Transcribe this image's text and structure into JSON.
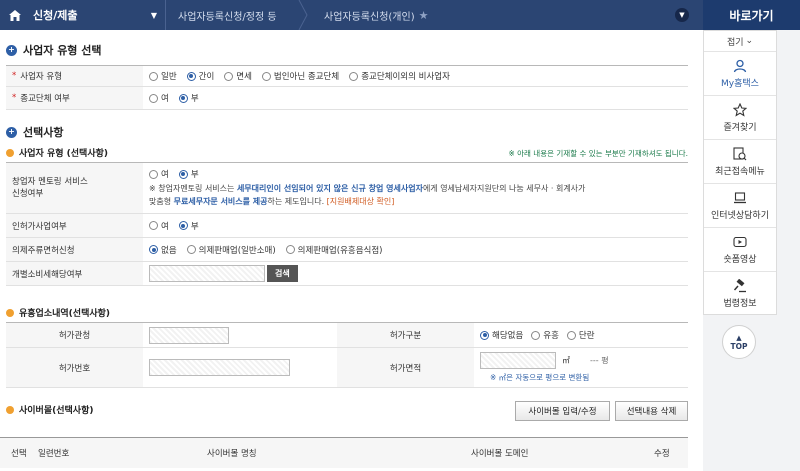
{
  "topbar": {
    "menu": "신청/제출",
    "crumb2": "사업자등록신청/정정 등",
    "crumb3": "사업자등록신청(개인)"
  },
  "section1": {
    "title": "사업자 유형 선택",
    "rows": [
      {
        "label": "사업자 유형",
        "options": [
          "일반",
          "간이",
          "면세",
          "법인아닌 종교단체",
          "종교단체이외의 비사업자"
        ],
        "selected": "간이"
      },
      {
        "label": "종교단체 여부",
        "options": [
          "여",
          "부"
        ],
        "selected": "부"
      }
    ]
  },
  "section2": {
    "title": "선택사항",
    "sub_title": "사업자 유형 (선택사항)",
    "note": "※ 아래 내용은 기재할 수 있는 부분만 기재하셔도 됩니다.",
    "mentoring": {
      "label_line1": "창업자 멘토링 서비스",
      "label_line2": "신청여부",
      "options": [
        "여",
        "부"
      ],
      "selected": "부",
      "desc_1": "※ 창업자멘토링 서비스는 ",
      "desc_hl1": "세무대리인이 선임되어 있지 않은 신규 창업 영세사업자",
      "desc_2": "에게 영세납세자지원단의 나눔 세무사 · 회계사가",
      "desc_3": "맞춤형 ",
      "desc_hl2": "무료세무자문 서비스를 제공",
      "desc_4": "하는 제도입니다. ",
      "desc_link": "[지원배제대상 확인]"
    },
    "permit_biz": {
      "label": "인허가사업여부",
      "options": [
        "여",
        "부"
      ],
      "selected": "부"
    },
    "liquor": {
      "label": "의제주류면허신청",
      "options": [
        "없음",
        "의제판매업(일반소매)",
        "의제판매업(유흥음식점)"
      ],
      "selected": "없음"
    },
    "excise": {
      "label": "개별소비세해당여부",
      "button": "검색"
    }
  },
  "entertainment": {
    "title": "유흥업소내역(선택사항)",
    "labels": {
      "office": "허가관청",
      "category": "허가구분",
      "number": "허가번호",
      "area": "허가면적"
    },
    "category_options": [
      "해당없음",
      "유흥",
      "단란"
    ],
    "category_selected": "해당없음",
    "area_unit": "㎡",
    "area_pyeong": "--- 평",
    "area_note": "※ ㎡은 자동으로 평으로 변환됨"
  },
  "cybermall": {
    "title": "사이버몰(선택사항)",
    "btn_input": "사이버몰 입력/수정",
    "btn_delete": "선택내용 삭제",
    "columns": [
      "선택",
      "일련번호",
      "사이버몰 명칭",
      "사이버몰 도메인",
      "수정"
    ]
  },
  "sidebar": {
    "title": "바로가기",
    "fold": "접기",
    "items": [
      {
        "label": "My홈택스",
        "icon": "person-icon"
      },
      {
        "label": "즐겨찾기",
        "icon": "star-icon"
      },
      {
        "label": "최근접속메뉴",
        "icon": "recent-icon"
      },
      {
        "label": "인터넷상담하기",
        "icon": "laptop-icon"
      },
      {
        "label": "숏폼영상",
        "icon": "video-icon"
      },
      {
        "label": "법령정보",
        "icon": "gavel-icon"
      }
    ],
    "top": "TOP"
  }
}
